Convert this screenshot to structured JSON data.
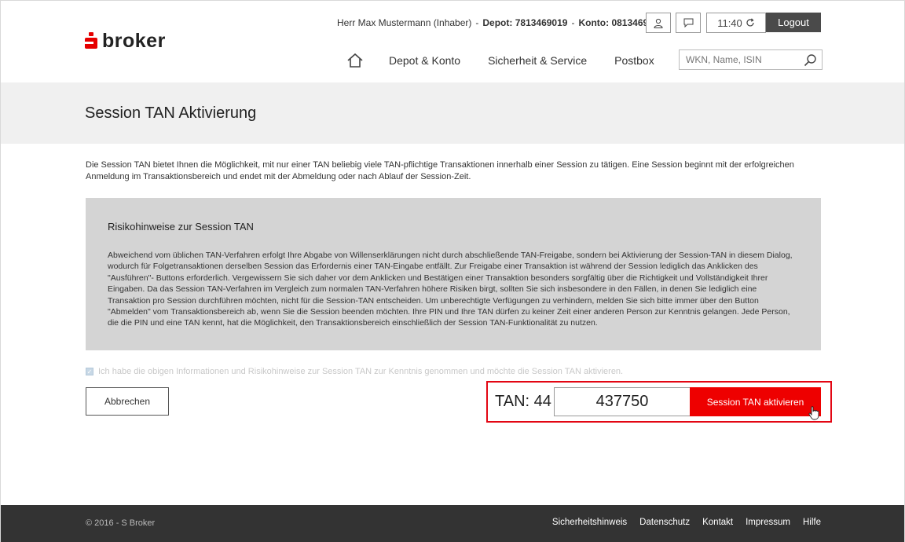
{
  "brand": {
    "name": "broker",
    "accent": "#e60000"
  },
  "header": {
    "user": "Herr Max Mustermann (Inhaber)",
    "depot": "Depot: 7813469019",
    "konto": "Konto: 0813469014",
    "time": "11:40",
    "logout": "Logout",
    "icons": [
      "person-icon",
      "message-icon",
      "refresh-icon"
    ]
  },
  "nav": {
    "items": [
      "Depot & Konto",
      "Sicherheit & Service",
      "Postbox"
    ],
    "search_placeholder": "WKN, Name, ISIN"
  },
  "page": {
    "title": "Session TAN Aktivierung",
    "intro": "Die Session TAN bietet Ihnen die Möglichkeit, mit nur einer TAN beliebig viele TAN-pflichtige Transaktionen innerhalb einer Session zu tätigen. Eine Session beginnt mit der erfolgreichen Anmeldung im Transaktionsbereich und endet mit der Abmeldung oder nach Ablauf der Session-Zeit."
  },
  "risk": {
    "title": "Risikohinweise zur Session TAN",
    "text": "Abweichend vom üblichen TAN-Verfahren erfolgt Ihre Abgabe von Willenserklärungen nicht durch abschließende TAN-Freigabe, sondern bei Aktivierung der Session-TAN in diesem Dialog, wodurch für Folgetransaktionen derselben Session das Erfordernis einer TAN-Eingabe entfällt. Zur Freigabe einer Transaktion ist während der Session lediglich das Anklicken des \"Ausführen\"- Buttons erforderlich. Vergewissern Sie sich daher vor dem Anklicken und Bestätigen einer Transaktion besonders sorgfältig über die Richtigkeit und Vollständigkeit Ihrer Eingaben. Da das Session TAN-Verfahren im Vergleich zum normalen TAN-Verfahren höhere Risiken birgt, sollten Sie sich insbesondere in den Fällen, in denen Sie lediglich eine Transaktion pro Session durchführen möchten, nicht für die Session-TAN entscheiden. Um unberechtigte Verfügungen zu verhindern, melden Sie sich bitte immer über den Button \"Abmelden\" vom Transaktionsbereich ab, wenn Sie die Session beenden möchten. Ihre PIN und Ihre TAN dürfen zu keiner Zeit einer anderen Person zur Kenntnis gelangen. Jede Person, die die PIN und eine TAN kennt, hat die Möglichkeit, den Transaktionsbereich einschließlich der Session TAN-Funktionalität zu nutzen."
  },
  "form": {
    "checkbox_label": "Ich habe die obigen Informationen und Risikohinweise zur Session TAN zur Kenntnis genommen und möchte die Session TAN aktivieren.",
    "checkbox_checked": true,
    "cancel": "Abbrechen",
    "tan_label": "TAN: 44",
    "tan_value": "437750",
    "submit": "Session TAN aktivieren"
  },
  "footer": {
    "copyright": "© 2016 - S Broker",
    "links": [
      "Sicherheitshinweis",
      "Datenschutz",
      "Kontakt",
      "Impressum",
      "Hilfe"
    ]
  }
}
